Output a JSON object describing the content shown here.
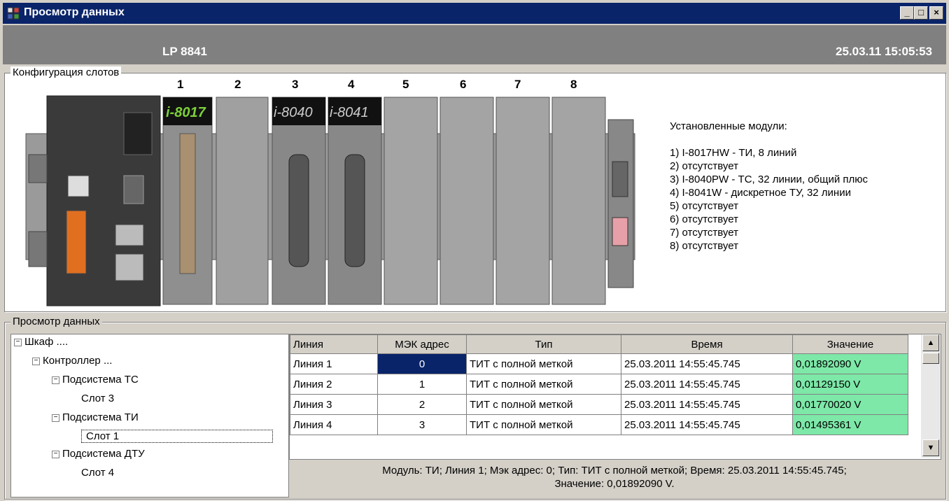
{
  "window": {
    "title": "Просмотр данных"
  },
  "header": {
    "device": "LP 8841",
    "datetime": "25.03.11 15:05:53"
  },
  "slot_config": {
    "label": "Конфигурация слотов",
    "slot_numbers": [
      "1",
      "2",
      "3",
      "4",
      "5",
      "6",
      "7",
      "8"
    ],
    "module_labels": {
      "slot1": "i-8017",
      "slot3": "i-8040",
      "slot4": "i-8041"
    },
    "installed_title": "Установленные модули:",
    "installed": [
      "1) I-8017HW - ТИ, 8 линий",
      "2) отсутствует",
      "3) I-8040PW - ТС, 32 линии, общий плюс",
      "4) I-8041W - дискретное ТУ, 32 линии",
      "5) отсутствует",
      "6) отсутствует",
      "7) отсутствует",
      "8) отсутствует"
    ]
  },
  "data_view": {
    "label": "Просмотр данных",
    "tree": [
      {
        "label": "Шкаф ....",
        "expander": "−"
      },
      {
        "label": "Контроллер ...",
        "expander": "−"
      },
      {
        "label": "Подсистема ТС",
        "expander": "−"
      },
      {
        "label": "Слот 3"
      },
      {
        "label": "Подсистема ТИ",
        "expander": "−"
      },
      {
        "label": "Слот 1"
      },
      {
        "label": "Подсистема ДТУ",
        "expander": "−"
      },
      {
        "label": "Слот 4"
      }
    ],
    "columns": [
      "Линия",
      "МЭК адрес",
      "Тип",
      "Время",
      "Значение"
    ],
    "rows": [
      [
        "Линия 1",
        "0",
        "ТИТ с полной меткой",
        "25.03.2011 14:55:45.745",
        "0,01892090 V"
      ],
      [
        "Линия 2",
        "1",
        "ТИТ с полной меткой",
        "25.03.2011 14:55:45.745",
        "0,01129150 V"
      ],
      [
        "Линия 3",
        "2",
        "ТИТ с полной меткой",
        "25.03.2011 14:55:45.745",
        "0,01770020 V"
      ],
      [
        "Линия 4",
        "3",
        "ТИТ с полной меткой",
        "25.03.2011 14:55:45.745",
        "0,01495361 V"
      ]
    ],
    "status_line1": "Модуль: ТИ; Линия 1; Мэк адрес: 0; Тип: ТИТ с полной меткой; Время: 25.03.2011 14:55:45.745;",
    "status_line2": "Значение: 0,01892090 V."
  },
  "colors": {
    "titlebar": "#0a246a",
    "header": "#808080",
    "value_cell": "#7de8a8",
    "selected": "#0a246a"
  }
}
